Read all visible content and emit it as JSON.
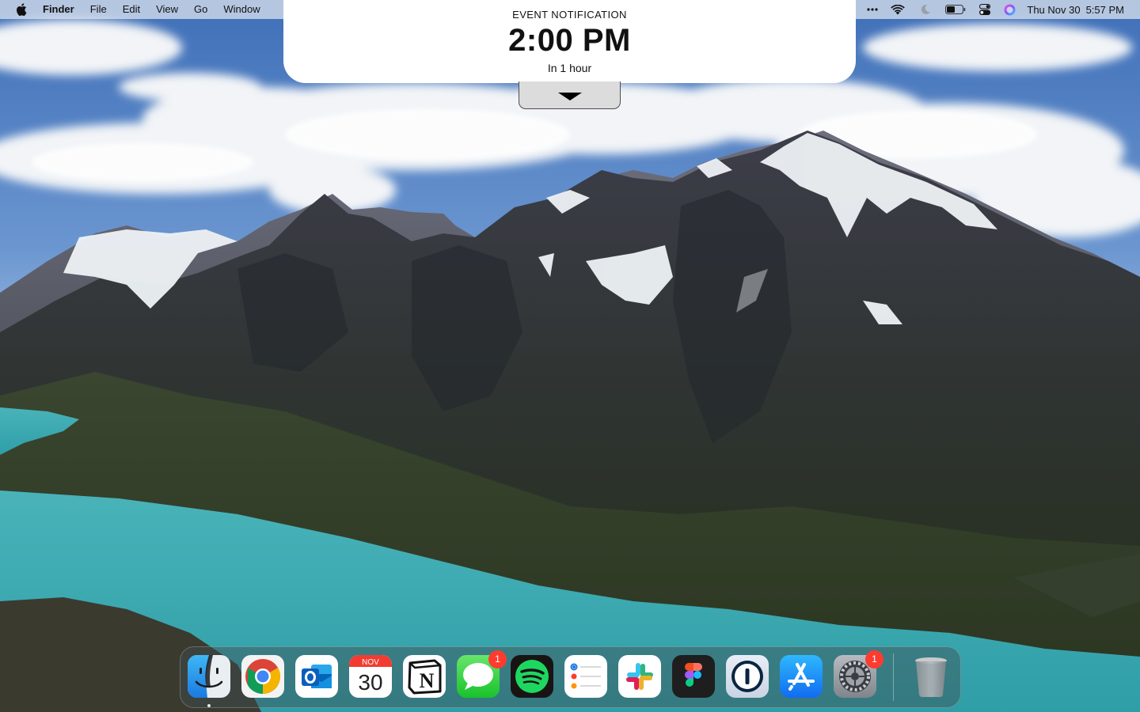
{
  "menubar": {
    "app_name": "Finder",
    "menus": [
      "File",
      "Edit",
      "View",
      "Go",
      "Window"
    ],
    "status_icons": [
      "more-icon",
      "wifi-icon",
      "focus-moon-icon",
      "battery-icon",
      "control-center-icon",
      "siri-icon"
    ],
    "clock_date": "Thu Nov 30",
    "clock_time": "5:57 PM"
  },
  "notification": {
    "eyebrow": "EVENT NOTIFICATION",
    "time": "2:00 PM",
    "relative": "In 1 hour"
  },
  "dock": {
    "apps": [
      {
        "name": "Finder",
        "icon": "finder-icon",
        "running": true
      },
      {
        "name": "Google Chrome",
        "icon": "chrome-icon"
      },
      {
        "name": "Microsoft Outlook",
        "icon": "outlook-icon"
      },
      {
        "name": "Calendar",
        "icon": "calendar-icon",
        "month": "NOV",
        "day": "30"
      },
      {
        "name": "Notion",
        "icon": "notion-icon",
        "glyph": "N"
      },
      {
        "name": "Messages",
        "icon": "messages-icon",
        "badge": "1"
      },
      {
        "name": "Spotify",
        "icon": "spotify-icon"
      },
      {
        "name": "Reminders",
        "icon": "reminders-icon"
      },
      {
        "name": "Slack",
        "icon": "slack-icon"
      },
      {
        "name": "Figma",
        "icon": "figma-icon"
      },
      {
        "name": "1Password",
        "icon": "onepassword-icon"
      },
      {
        "name": "App Store",
        "icon": "app-store-icon"
      },
      {
        "name": "System Settings",
        "icon": "system-settings-icon",
        "badge": "1"
      },
      {
        "name": "Trash",
        "icon": "trash-icon"
      }
    ]
  }
}
